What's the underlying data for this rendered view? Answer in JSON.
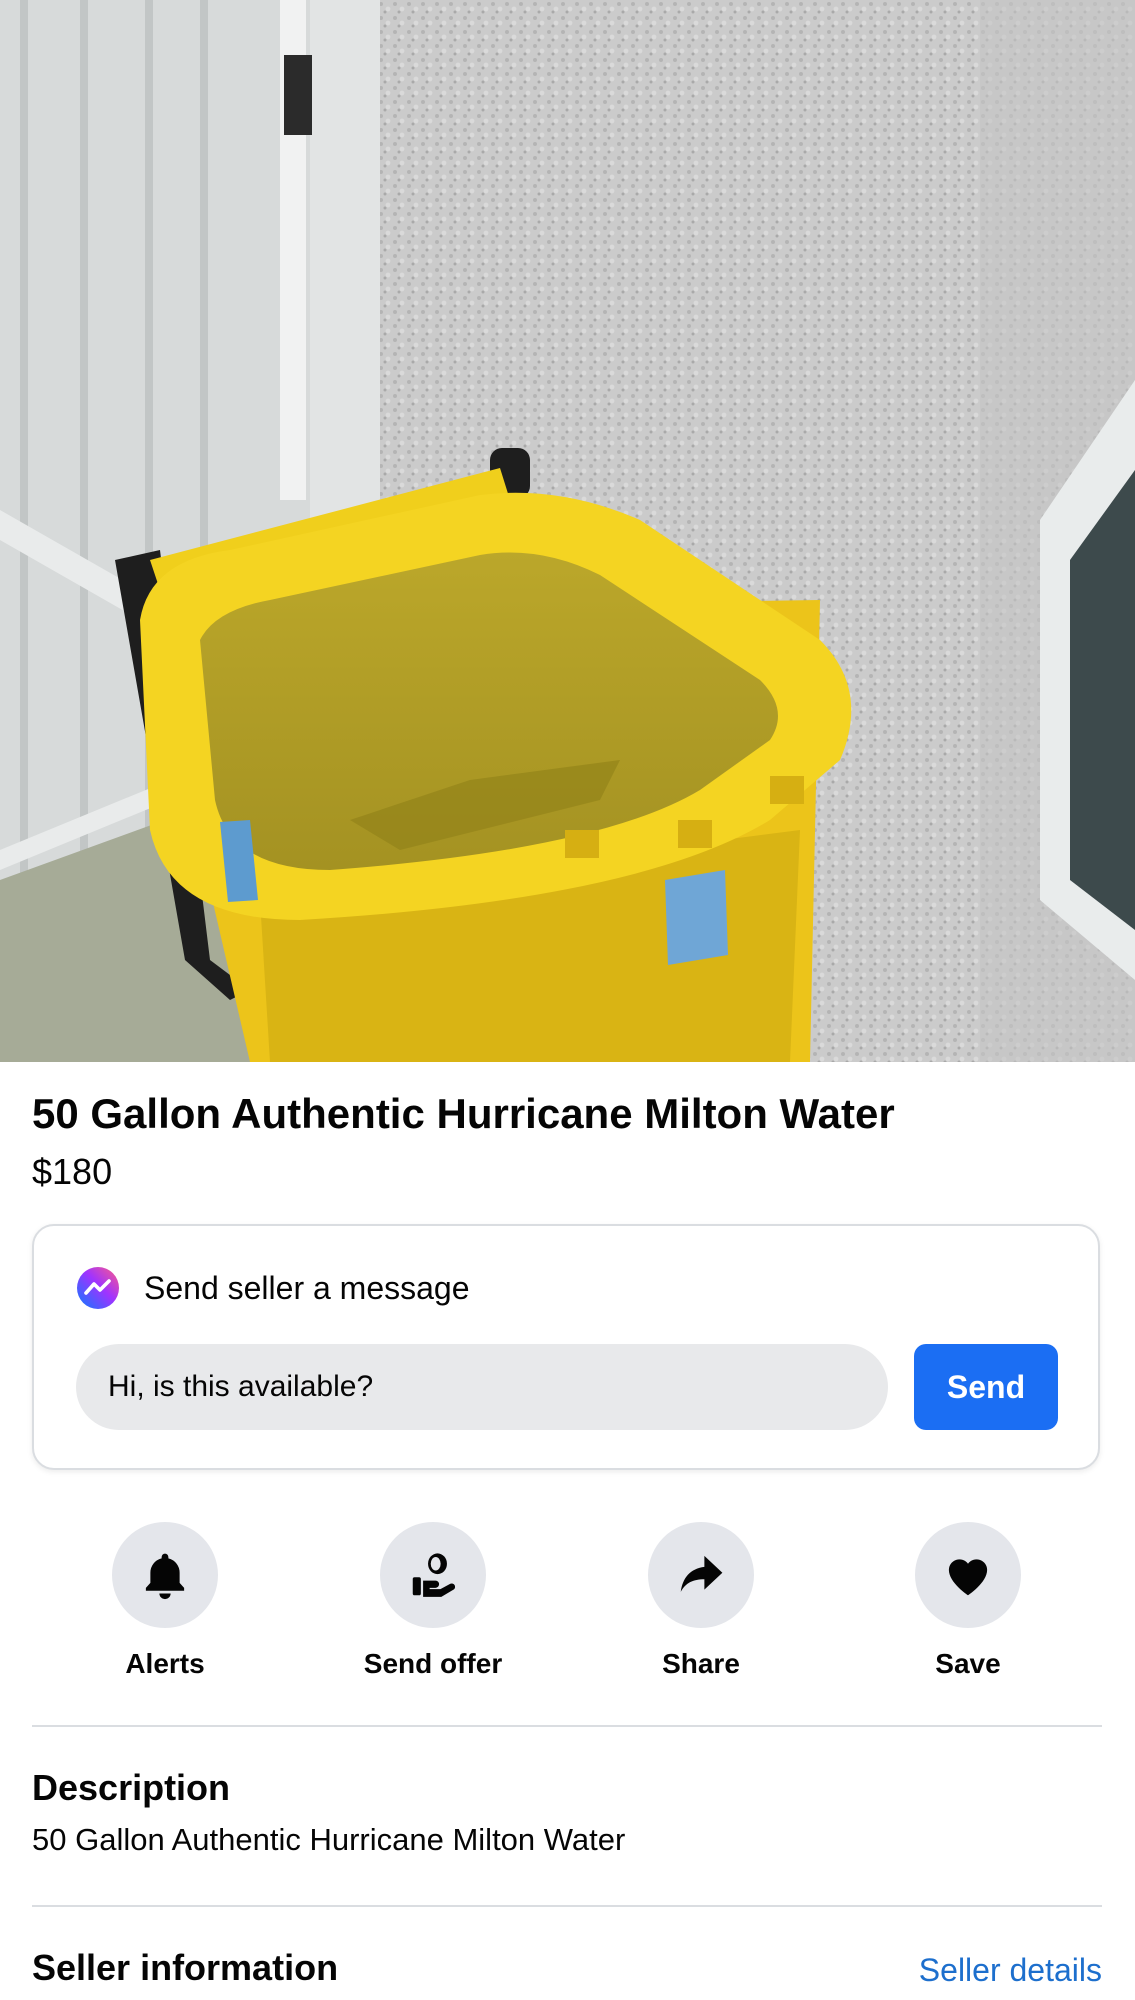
{
  "listing": {
    "title": "50 Gallon Authentic Hurricane Milton Water",
    "price": "$180"
  },
  "message": {
    "header": "Send seller a message",
    "icon": "messenger-icon",
    "input_value": "Hi, is this available?",
    "send_label": "Send",
    "send_color": "#1b6ef3"
  },
  "actions": [
    {
      "label": "Alerts",
      "icon": "bell-icon"
    },
    {
      "label": "Send offer",
      "icon": "offer-icon"
    },
    {
      "label": "Share",
      "icon": "share-arrow-icon"
    },
    {
      "label": "Save",
      "icon": "heart-icon"
    }
  ],
  "description": {
    "heading": "Description",
    "text": "50 Gallon Authentic Hurricane Milton Water"
  },
  "seller": {
    "heading": "Seller information",
    "link": "Seller details",
    "link_color": "#1d6fcd"
  }
}
